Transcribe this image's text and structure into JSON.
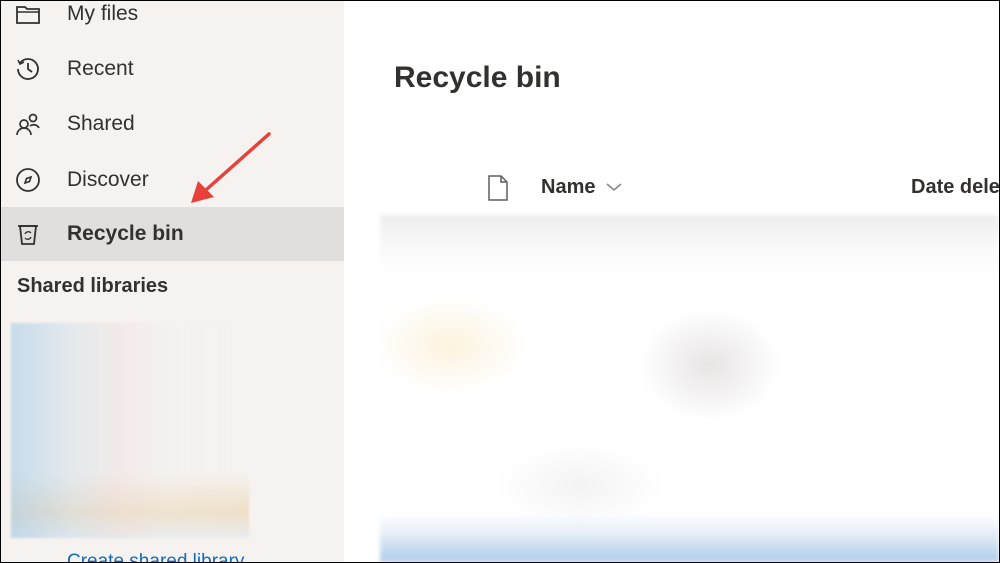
{
  "sidebar": {
    "items": [
      {
        "label": "My files",
        "icon": "folder-icon"
      },
      {
        "label": "Recent",
        "icon": "history-icon"
      },
      {
        "label": "Shared",
        "icon": "people-icon"
      },
      {
        "label": "Discover",
        "icon": "compass-icon"
      },
      {
        "label": "Recycle bin",
        "icon": "recycle-bin-icon",
        "active": true
      }
    ],
    "shared_libraries_header": "Shared libraries",
    "create_link": "Create shared library"
  },
  "main": {
    "title": "Recycle bin",
    "columns": {
      "name": "Name",
      "date": "Date dele"
    }
  },
  "colors": {
    "sidebar_bg": "#f6f2ef",
    "active_bg": "#e1dfdd",
    "annotation_arrow": "#e8413a"
  }
}
